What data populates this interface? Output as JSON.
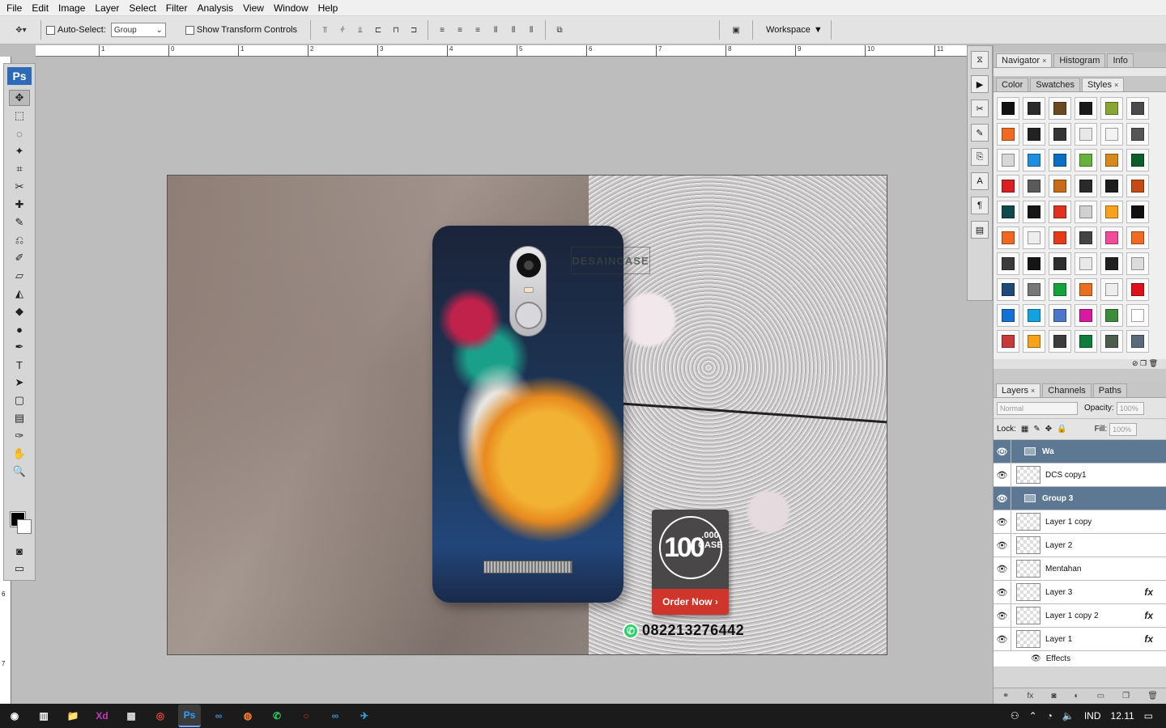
{
  "menu": [
    "File",
    "Edit",
    "Image",
    "Layer",
    "Select",
    "Filter",
    "Analysis",
    "View",
    "Window",
    "Help"
  ],
  "options": {
    "auto_select_label": "Auto-Select:",
    "auto_select_value": "Group",
    "transform_label": "Show Transform Controls",
    "workspace_label": "Workspace"
  },
  "ruler_ticks": [
    "1",
    "0",
    "1",
    "2",
    "3",
    "4",
    "5",
    "6",
    "7",
    "8",
    "9",
    "10",
    "11"
  ],
  "ruler_left_ticks": [
    "6",
    "7"
  ],
  "toolbox": {
    "logo": "Ps",
    "tools": [
      "move-tool",
      "marquee-tool",
      "lasso-tool",
      "magic-wand-tool",
      "crop-tool",
      "slice-tool",
      "healing-brush-tool",
      "brush-tool",
      "clone-stamp-tool",
      "history-brush-tool",
      "eraser-tool",
      "paint-bucket-tool",
      "blur-tool",
      "dodge-tool",
      "pen-tool",
      "type-tool",
      "path-selection-tool",
      "shape-tool",
      "notes-tool",
      "eyedropper-tool",
      "hand-tool",
      "zoom-tool"
    ]
  },
  "canvas": {
    "watermark": "DESAINCASE",
    "promo_number": "100",
    "promo_sub": ".000 CASE",
    "order_label": "Order Now ›",
    "whatsapp_number": "082213276442"
  },
  "panels": {
    "top_tabs": [
      "Navigator",
      "Histogram",
      "Info"
    ],
    "mid_tabs": [
      "Color",
      "Swatches",
      "Styles"
    ],
    "layer_tabs": [
      "Layers",
      "Channels",
      "Paths"
    ],
    "blend_mode": "Normal",
    "opacity_label": "Opacity:",
    "opacity_value": "100%",
    "lock_label": "Lock:",
    "fill_label": "Fill:",
    "fill_value": "100%"
  },
  "styles": [
    "#111111",
    "#2b2b2b",
    "#6b4a20",
    "#1a1a1a",
    "#8aa632",
    "#4a4a4a",
    "#f26a21",
    "#222222",
    "#333333",
    "#e8e8e8",
    "#f3f3f3",
    "#555555",
    "#d8d8d8",
    "#1e8fe0",
    "#0a6fc4",
    "#66b33c",
    "#d48b1b",
    "#0b5d2a",
    "#d91f1f",
    "#5a5a5a",
    "#c76a1a",
    "#2a2a2a",
    "#1c1c1c",
    "#c64a16",
    "#0e4a4a",
    "#161616",
    "#e0311f",
    "#d0d0d0",
    "#f7a11c",
    "#101010",
    "#f06820",
    "#eeeeee",
    "#e53b1a",
    "#444444",
    "#f04c9a",
    "#f36b22",
    "#3a3a3a",
    "#151515",
    "#2e2e2e",
    "#e9e9e9",
    "#202020",
    "#dcdcdc",
    "#1d4a7a",
    "#777777",
    "#14a33a",
    "#e86f1f",
    "#ededed",
    "#e0101a",
    "#1570d6",
    "#13a2df",
    "#4c78c9",
    "#d81aa0",
    "#3c8c3c",
    "#ffffff",
    "#c83a3a",
    "#f7a21d",
    "#3c3c3c",
    "#0e7d3c",
    "#4d5d4d",
    "#5a6a7a"
  ],
  "layers": [
    {
      "name": "Wa",
      "type": "group"
    },
    {
      "name": "DCS copy1",
      "type": "layer",
      "fx": ""
    },
    {
      "name": "Group 3",
      "type": "group"
    },
    {
      "name": "Layer 1 copy",
      "type": "layer",
      "fx": ""
    },
    {
      "name": "Layer 2",
      "type": "layer",
      "fx": ""
    },
    {
      "name": "Mentahan",
      "type": "layer",
      "fx": ""
    },
    {
      "name": "Layer 3",
      "type": "layer",
      "fx": "fx"
    },
    {
      "name": "Layer 1 copy 2",
      "type": "layer",
      "fx": "fx"
    },
    {
      "name": "Layer 1",
      "type": "layer",
      "fx": "fx"
    }
  ],
  "effects_label": "Effects",
  "taskbar": {
    "apps": [
      "cortana",
      "task-view",
      "file-explorer",
      "adobe-xd",
      "calculator",
      "chrome",
      "photoshop",
      "app-1",
      "firefox",
      "whatsapp",
      "opera",
      "app-2",
      "telegram"
    ],
    "app_labels": [
      "",
      "",
      "",
      "Xd",
      "",
      "",
      "Ps",
      "",
      "",
      "",
      "",
      "",
      ""
    ],
    "language": "IND",
    "time": "12.11"
  }
}
